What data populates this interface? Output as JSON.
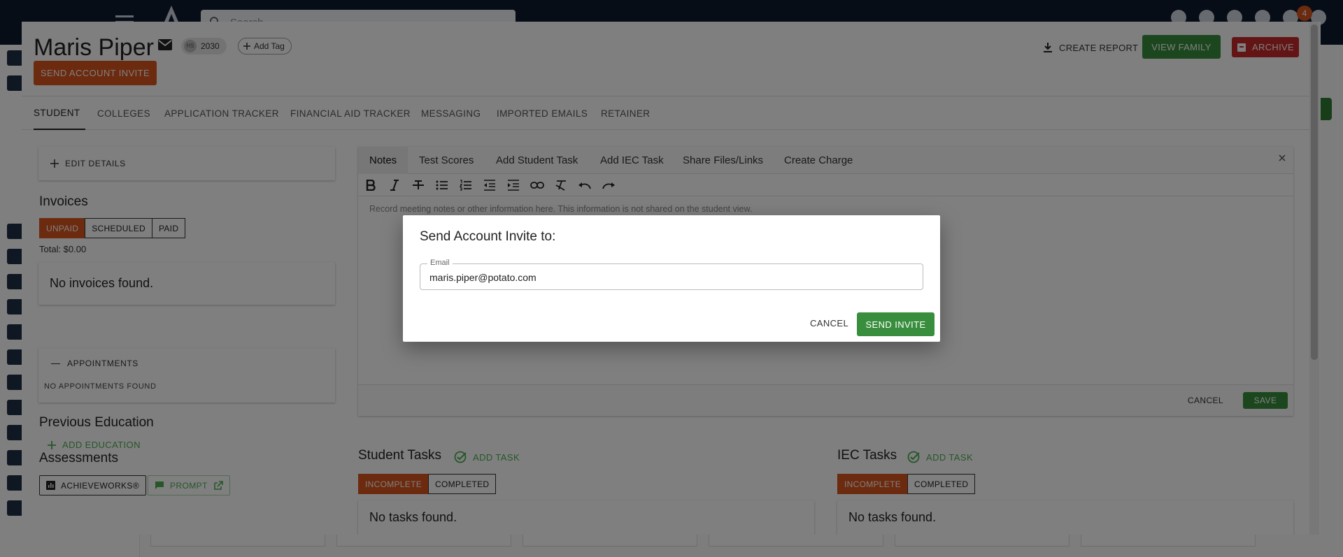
{
  "background": {
    "search_placeholder": "Search",
    "notification_count": "4"
  },
  "student": {
    "name": "Maris Piper",
    "grade_badge": "HS",
    "grad_year": "2030",
    "add_tag_label": "Add Tag",
    "invite_button_label": "SEND ACCOUNT INVITE"
  },
  "header_actions": {
    "create_report_label": "CREATE REPORT",
    "view_family_label": "VIEW FAMILY",
    "archive_label": "ARCHIVE"
  },
  "tabs": [
    {
      "label": "STUDENT",
      "active": true
    },
    {
      "label": "COLLEGES"
    },
    {
      "label": "APPLICATION TRACKER"
    },
    {
      "label": "FINANCIAL AID TRACKER"
    },
    {
      "label": "MESSAGING"
    },
    {
      "label": "IMPORTED EMAILS"
    },
    {
      "label": "RETAINER"
    }
  ],
  "edit_details_label": "EDIT DETAILS",
  "invoices": {
    "title": "Invoices",
    "filters": [
      "UNPAID",
      "SCHEDULED",
      "PAID"
    ],
    "active_filter": "UNPAID",
    "total": "Total: $0.00",
    "empty": "No invoices found."
  },
  "appointments": {
    "title": "APPOINTMENTS",
    "empty": "NO APPOINTMENTS FOUND"
  },
  "previous_education": {
    "title": "Previous Education",
    "add_label": "ADD EDUCATION"
  },
  "assessments": {
    "title": "Assessments",
    "buttons": [
      "ACHIEVEWORKS®",
      "PROMPT"
    ]
  },
  "notes_panel": {
    "tabs": [
      "Notes",
      "Test Scores",
      "Add Student Task",
      "Add IEC Task",
      "Share Files/Links",
      "Create Charge"
    ],
    "active_tab": "Notes",
    "placeholder": "Record meeting notes or other information here. This information is not shared on the student view.",
    "cancel_label": "CANCEL",
    "save_label": "SAVE",
    "close_icon": "close-icon",
    "toolbar": [
      "bold-icon",
      "italic-icon",
      "strikethrough-icon",
      "bullet-list-icon",
      "numbered-list-icon",
      "outdent-icon",
      "indent-icon",
      "link-icon",
      "clear-format-icon",
      "undo-icon",
      "redo-icon"
    ]
  },
  "student_tasks": {
    "title": "Student Tasks",
    "add_label": "ADD TASK",
    "filters": [
      "INCOMPLETE",
      "COMPLETED"
    ],
    "active_filter": "INCOMPLETE",
    "empty": "No tasks found."
  },
  "iec_tasks": {
    "title": "IEC Tasks",
    "add_label": "ADD TASK",
    "filters": [
      "INCOMPLETE",
      "COMPLETED"
    ],
    "active_filter": "INCOMPLETE",
    "empty": "No tasks found."
  },
  "modal": {
    "title": "Send Account Invite to:",
    "email_label": "Email",
    "email_value": "maris.piper@potato.com",
    "cancel_label": "CANCEL",
    "send_label": "SEND INVITE"
  },
  "colors": {
    "accent_orange": "#d9541e",
    "primary_green": "#388e3c",
    "archive_red": "#c62828",
    "topbar_navy": "#0d1b2e"
  }
}
